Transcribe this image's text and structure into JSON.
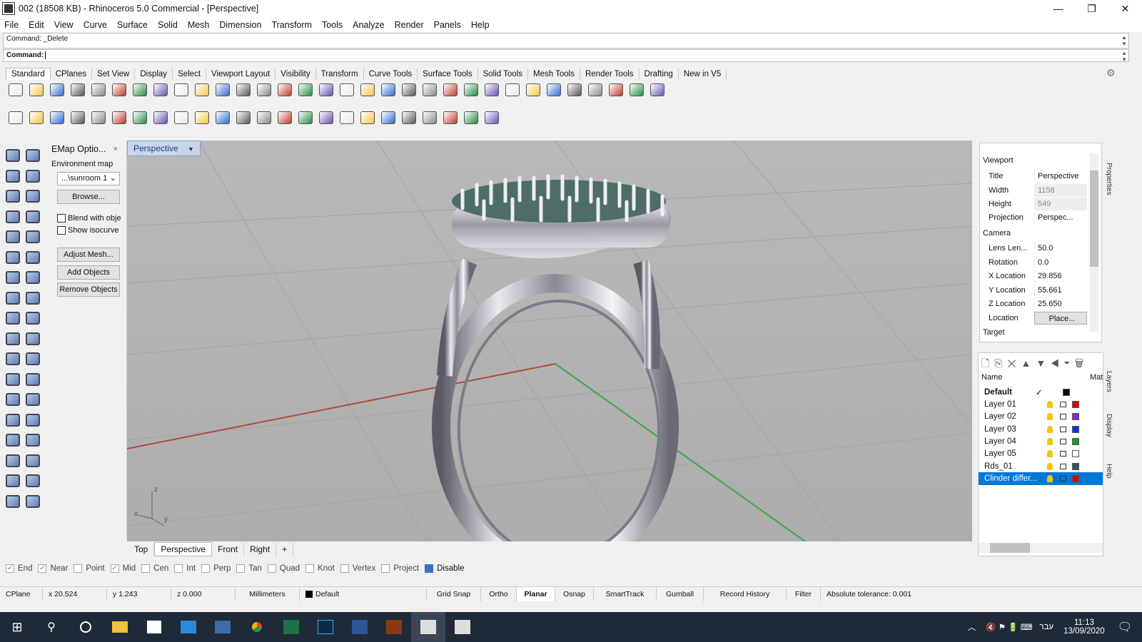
{
  "window": {
    "title": "002 (18508 KB) - Rhinoceros 5.0 Commercial - [Perspective]",
    "minimize": "—",
    "restore": "❐",
    "close": "✕"
  },
  "menu": [
    "File",
    "Edit",
    "View",
    "Curve",
    "Surface",
    "Solid",
    "Mesh",
    "Dimension",
    "Transform",
    "Tools",
    "Analyze",
    "Render",
    "Panels",
    "Help"
  ],
  "command": {
    "history": "Command: _Delete",
    "prompt": "Command:",
    "input": ""
  },
  "toolbar_tabs": [
    "Standard",
    "CPlanes",
    "Set View",
    "Display",
    "Select",
    "Viewport Layout",
    "Visibility",
    "Transform",
    "Curve Tools",
    "Surface Tools",
    "Solid Tools",
    "Mesh Tools",
    "Render Tools",
    "Drafting",
    "New in V5"
  ],
  "toolbar_row1_icons": [
    "new-icon",
    "open-icon",
    "save-icon",
    "print-icon",
    "import-icon",
    "cut-icon",
    "copy-icon",
    "paste-icon",
    "undo-icon",
    "pan-icon",
    "move-view-icon",
    "zoom-icon",
    "zoom-window-icon",
    "zoom-extents-icon",
    "zoom-selected-icon",
    "rotate-view-icon",
    "four-views-icon",
    "cplane-icon",
    "set-view-icon",
    "circle-icon",
    "box-icon",
    "light-icon",
    "lock-icon",
    "layer-icon",
    "color-wheel-icon",
    "render-sphere-icon",
    "rendered-icon",
    "material-icon",
    "select-filter-icon",
    "options-icon",
    "osnap-icon",
    "help-icon"
  ],
  "toolbar_row2_icons": [
    "dim-linear-icon",
    "dim-aligned-icon",
    "dim-rotated-icon",
    "dim-angle-icon",
    "dim-radius-icon",
    "dim-diameter-icon",
    "leader-icon",
    "dim-ordinate-icon",
    "check-icon",
    "text-icon",
    "text-block-icon",
    "dot-icon",
    "leader2-icon",
    "dim-edit-icon",
    "hatch-icon",
    "clipping-icon",
    "block-icon",
    "layout-icon",
    "detail-icon",
    "table-icon",
    "folder-icon",
    "sphere-icon",
    "snap-icon",
    "unlock-icon"
  ],
  "left_palette": [
    "select-icon",
    "point-icon",
    "polyline-icon",
    "curve-icon",
    "circle-tool-icon",
    "arc-tool-icon",
    "polygon-icon",
    "rectangle-icon",
    "ellipse-icon",
    "fillet-icon",
    "surface-icon",
    "revolve-icon",
    "box-solid-icon",
    "boolean-icon",
    "cylinder-icon",
    "extrude-icon",
    "mesh-tool-icon",
    "shell-icon",
    "split-icon",
    "trim-icon",
    "group-icon",
    "explode-icon",
    "join-icon",
    "offset-icon",
    "text-tool-icon",
    "scale-icon",
    "array-icon",
    "align-icon",
    "mirror-icon",
    "orient-icon",
    "grid-icon",
    "dim-tool-icon",
    "cage-icon",
    "check-tool-icon",
    "render-tool-icon",
    "light-tool-icon"
  ],
  "emap": {
    "title": "EMap Optio...",
    "close": "×",
    "section": "Environment map",
    "select": "...\\sunroom 1",
    "browse": "Browse...",
    "blend": "Blend with obje",
    "iso": "Show isocurve",
    "adjust": "Adjust Mesh...",
    "add": "Add Objects",
    "remove": "Remove Objects"
  },
  "viewport": {
    "tab": "Perspective",
    "tabs": [
      "Top",
      "Perspective",
      "Front",
      "Right"
    ],
    "add": "+",
    "axis_z": "z",
    "axis_x": "x",
    "axis_y": "y"
  },
  "properties": {
    "section_viewport": "Viewport",
    "rows": [
      {
        "k": "Title",
        "v": "Perspective",
        "gray": false
      },
      {
        "k": "Width",
        "v": "1158",
        "gray": true
      },
      {
        "k": "Height",
        "v": "549",
        "gray": true
      },
      {
        "k": "Projection",
        "v": "Perspec...",
        "gray": false
      }
    ],
    "section_camera": "Camera",
    "camera": [
      {
        "k": "Lens Len...",
        "v": "50.0"
      },
      {
        "k": "Rotation",
        "v": "0.0"
      },
      {
        "k": "X Location",
        "v": "29.856"
      },
      {
        "k": "Y Location",
        "v": "55.661"
      },
      {
        "k": "Z Location",
        "v": "25.650"
      },
      {
        "k": "Location",
        "v": "Place..."
      }
    ],
    "section_target": "Target"
  },
  "sidetabs": [
    "Properties",
    "Layers",
    "Display",
    "Help"
  ],
  "layers": {
    "header_name": "Name",
    "header_mat": "Mat",
    "rows": [
      {
        "name": "Default",
        "color": "#000000",
        "current": true,
        "selected": false
      },
      {
        "name": "Layer 01",
        "color": "#e00000",
        "current": false,
        "selected": false
      },
      {
        "name": "Layer 02",
        "color": "#8b2bc8",
        "current": false,
        "selected": false
      },
      {
        "name": "Layer 03",
        "color": "#1030e0",
        "current": false,
        "selected": false
      },
      {
        "name": "Layer 04",
        "color": "#1a9a1a",
        "current": false,
        "selected": false
      },
      {
        "name": "Layer 05",
        "color": "#ffffff",
        "current": false,
        "selected": false
      },
      {
        "name": "Rds_01",
        "color": "#3a5560",
        "current": false,
        "selected": false
      },
      {
        "name": "Clinder differ...",
        "color": "#e00000",
        "current": false,
        "selected": true
      }
    ],
    "check": "✓"
  },
  "osnap": [
    {
      "label": "End",
      "on": true
    },
    {
      "label": "Near",
      "on": true
    },
    {
      "label": "Point",
      "on": false
    },
    {
      "label": "Mid",
      "on": true
    },
    {
      "label": "Cen",
      "on": false
    },
    {
      "label": "Int",
      "on": false
    },
    {
      "label": "Perp",
      "on": false
    },
    {
      "label": "Tan",
      "on": false
    },
    {
      "label": "Quad",
      "on": false
    },
    {
      "label": "Knot",
      "on": false
    },
    {
      "label": "Vertex",
      "on": false
    },
    {
      "label": "Project",
      "on": false
    },
    {
      "label": "Disable",
      "on": false
    }
  ],
  "status": {
    "cplane": "CPlane",
    "x": "x 20.524",
    "y": "y 1.243",
    "z": "z 0.000",
    "units": "Millimeters",
    "layer": "Default",
    "grid_snap": "Grid Snap",
    "ortho": "Ortho",
    "planar": "Planar",
    "osnap": "Osnap",
    "smarttrack": "SmartTrack",
    "gumball": "Gumball",
    "record_history": "Record History",
    "filter": "Filter",
    "tolerance": "Absolute tolerance: 0.001"
  },
  "taskbar": {
    "time": "11:13",
    "date": "13/09/2020",
    "lang": "עבר"
  },
  "colors": {
    "accent": "#0078d7",
    "viewport_bg": "#b3b3b3",
    "x_axis": "#c0392b",
    "y_axis": "#2ea043"
  }
}
